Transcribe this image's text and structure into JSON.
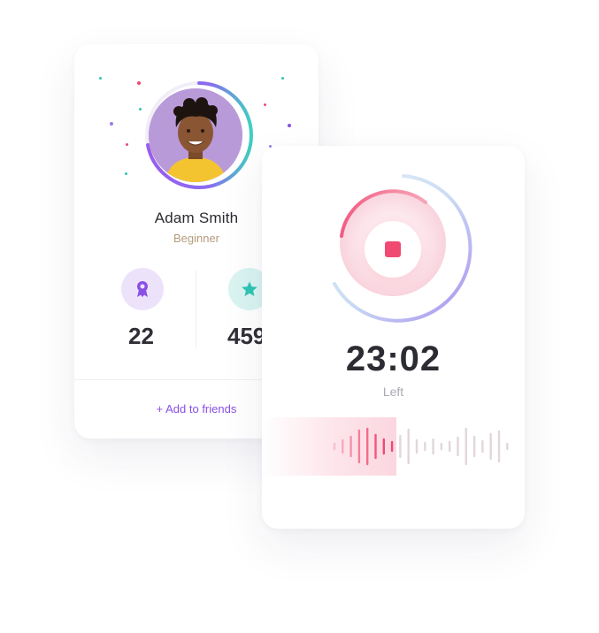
{
  "profile": {
    "name": "Adam Smith",
    "level": "Beginner",
    "progress_ring_fraction": 0.72,
    "stats": [
      {
        "icon": "ribbon-badge-icon",
        "value": "22",
        "color": "#8a4fe6"
      },
      {
        "icon": "star-icon",
        "value": "459",
        "color": "#2ec5b4"
      }
    ],
    "add_friends_label": "+ Add to friends"
  },
  "timer": {
    "time": "23:02",
    "label": "Left",
    "progress_fraction": 0.45,
    "accent_color": "#f04a72"
  },
  "colors": {
    "purple": "#8a4fe6",
    "teal": "#2ec5b4",
    "pink": "#f04a72"
  }
}
